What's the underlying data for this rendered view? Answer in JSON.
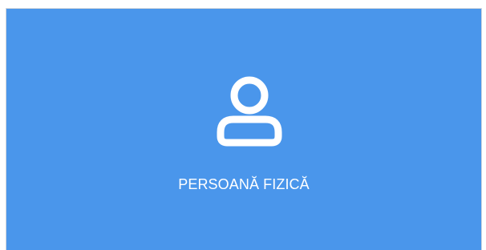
{
  "card": {
    "label": "PERSOANĂ FIZICĂ",
    "icon": "user-icon",
    "background_color": "#4a96eb",
    "text_color": "#ffffff"
  }
}
